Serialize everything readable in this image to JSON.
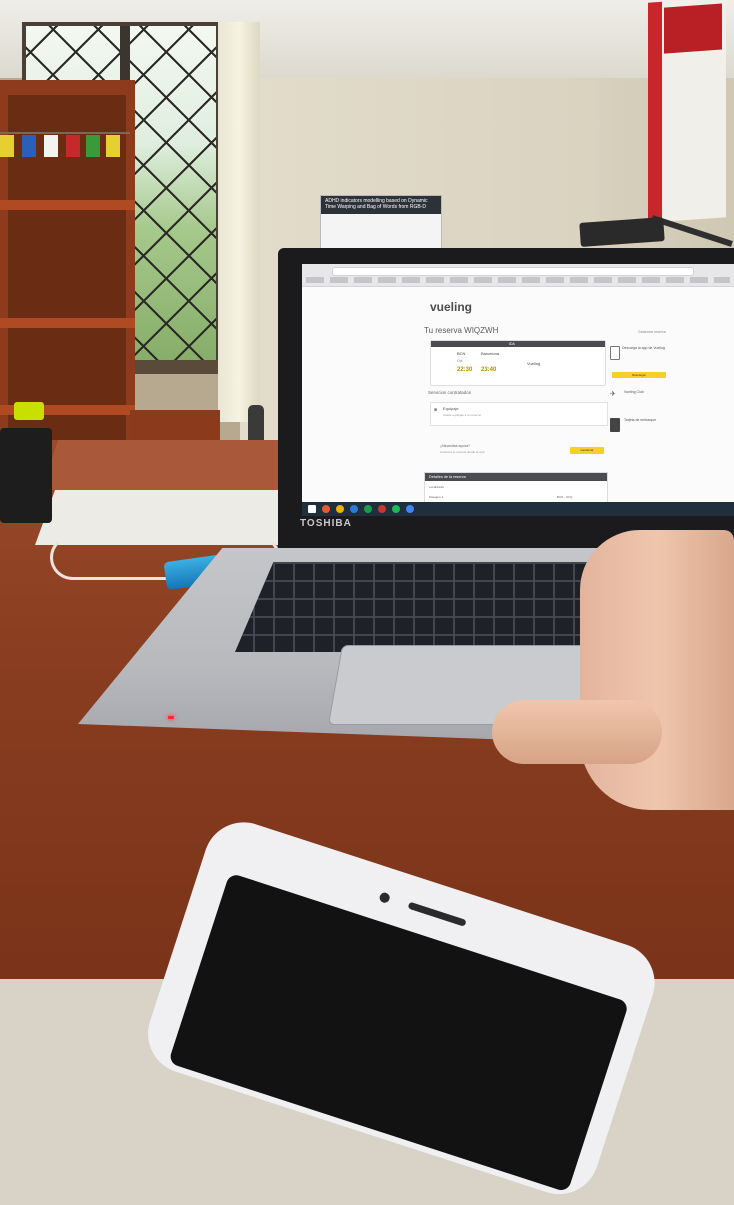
{
  "laptop": {
    "brand": "TOSHIBA",
    "browser": {
      "site_logo": "vueling",
      "booking_title": "Tu reserva WIQZWH",
      "manage_link": "Gestionar reserva",
      "flight_card": {
        "header": "IDA",
        "origin": "BCN",
        "destination": "Barcelona",
        "departure_time": "22:30",
        "arrival_time": "23:40",
        "airline_label": "Vueling",
        "date_small": "Oct"
      },
      "services_title": "Servicios contratados",
      "service_item": {
        "label": "Equipaje",
        "description": "Añade equipaje a tu reserva"
      },
      "help": {
        "label": "¿Necesitas ayuda?",
        "description": "Gestiona tu reserva desde la web",
        "button": "Gestionar"
      },
      "reservation": {
        "title": "Detalles de la reserva",
        "row1": "Localizador",
        "row2": "Pasajero 1",
        "row3": "Nombre",
        "right": "BCN - SVQ"
      },
      "side_panel": {
        "item1": "Descarga la app de Vueling",
        "button": "Descargar",
        "item2": "Vueling Club",
        "item3": "Tarjeta de embarque"
      }
    }
  },
  "posters": {
    "center_title": "ADHD indicators modelling based on Dynamic Time Warping and Bag of Words from RGB-D"
  },
  "colors": {
    "accent_yellow": "#f6cf2a",
    "taskbar": "#1f2f3e",
    "led": "#ff2a2a",
    "usb_device": "#1e8fd0"
  }
}
